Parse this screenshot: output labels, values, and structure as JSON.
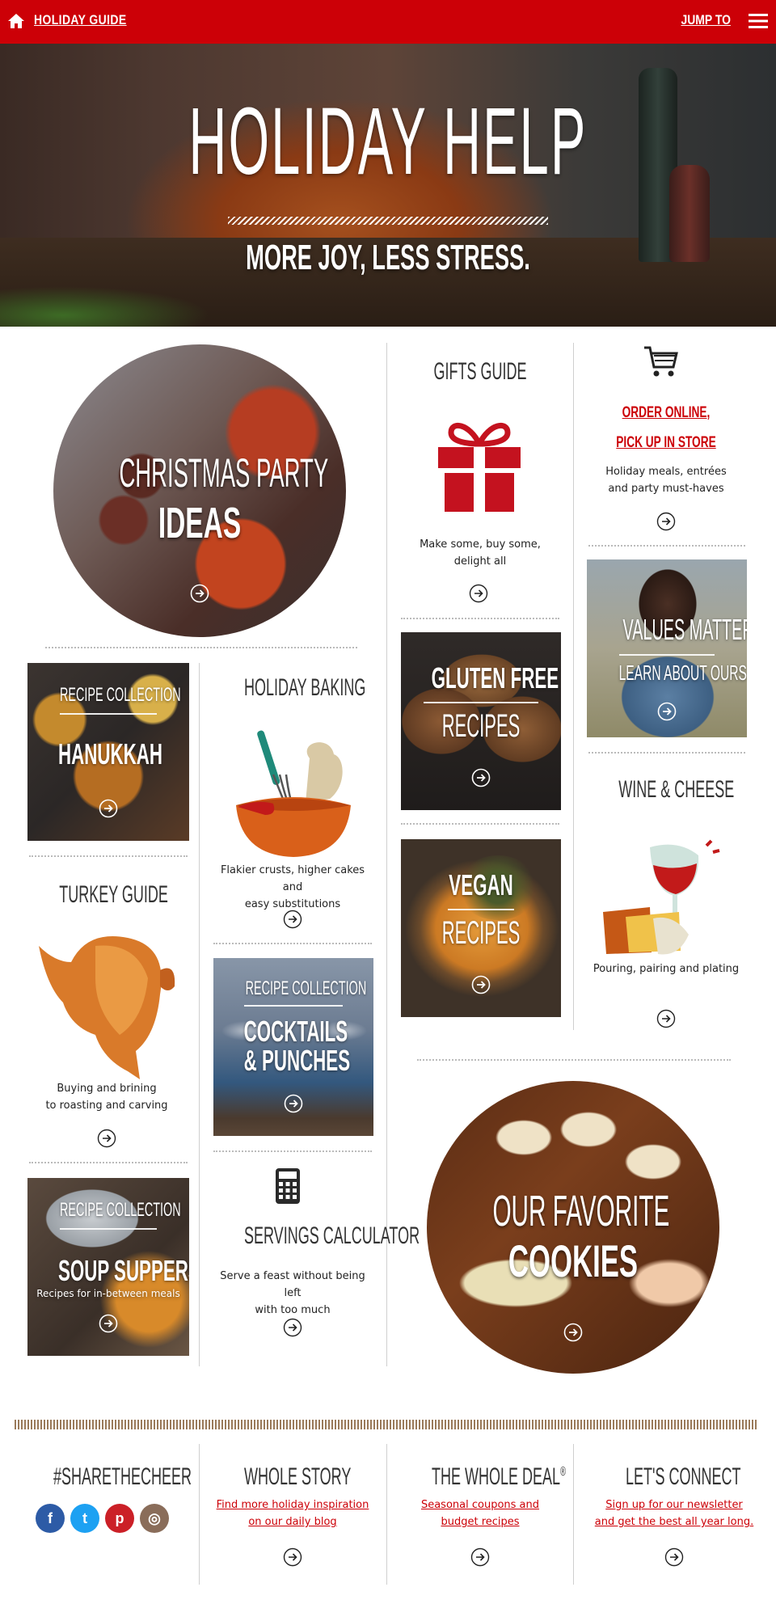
{
  "topbar": {
    "title": "HOLIDAY GUIDE",
    "jump": "JUMP TO"
  },
  "hero": {
    "title": "HOLIDAY HELP",
    "subtitle": "MORE JOY, LESS STRESS."
  },
  "christmas": {
    "line1": "CHRISTMAS PARTY",
    "line2": "IDEAS"
  },
  "gifts": {
    "title": "GIFTS GUIDE",
    "caption1": "Make some, buy some,",
    "caption2": "delight all"
  },
  "order": {
    "link1": "ORDER ONLINE,",
    "link2": "PICK UP IN STORE",
    "caption1": "Holiday meals, entrées",
    "caption2": "and party must-haves"
  },
  "values": {
    "line1": "VALUES MATTER",
    "line2": "LEARN ABOUT OURS"
  },
  "hanukkah": {
    "kicker": "RECIPE COLLECTION",
    "title": "HANUKKAH"
  },
  "baking": {
    "title": "HOLIDAY BAKING",
    "caption1": "Flakier crusts, higher cakes and",
    "caption2": "easy substitutions"
  },
  "gluten": {
    "line1": "GLUTEN FREE",
    "line2": "RECIPES"
  },
  "vegan": {
    "line1": "VEGAN",
    "line2": "RECIPES"
  },
  "wine": {
    "title": "WINE & CHEESE",
    "caption": "Pouring, pairing and plating"
  },
  "turkey": {
    "title": "TURKEY GUIDE",
    "caption1": "Buying and brining",
    "caption2": "to roasting and carving"
  },
  "cocktails": {
    "kicker": "RECIPE COLLECTION",
    "line1": "COCKTAILS",
    "line2": "& PUNCHES"
  },
  "soup": {
    "kicker": "RECIPE COLLECTION",
    "title": "SOUP SUPPERS",
    "caption": "Recipes for in-between meals"
  },
  "calculator": {
    "title": "SERVINGS CALCULATOR",
    "caption1": "Serve a feast without being left",
    "caption2": "with too much"
  },
  "cookies": {
    "line1": "OUR FAVORITE",
    "line2": "COOKIES"
  },
  "footer": {
    "share": {
      "title": "#SHARETHECHEER"
    },
    "story": {
      "title": "WHOLE STORY",
      "link1": "Find more holiday inspiration",
      "link2": "on our daily blog"
    },
    "deal": {
      "title": "THE WHOLE DEAL",
      "reg": "®",
      "link1": "Seasonal coupons and",
      "link2": "budget recipes"
    },
    "connect": {
      "title": "LET'S CONNECT",
      "link1": "Sign up for our newsletter",
      "link2": "and get the best all year long."
    }
  },
  "social": {
    "facebook": "f",
    "twitter": "t",
    "pinterest": "p",
    "instagram": "◎"
  },
  "icons": [
    "home-icon",
    "menu-icon",
    "cart-icon",
    "gift-icon",
    "calculator-icon",
    "arrow-right-icon"
  ],
  "colors": {
    "brand_red": "#cc0007",
    "gift_red": "#c4121f",
    "facebook": "#2d5ba6",
    "twitter": "#1da1f2",
    "pinterest": "#cb2027",
    "instagram": "#8a6d5a"
  }
}
